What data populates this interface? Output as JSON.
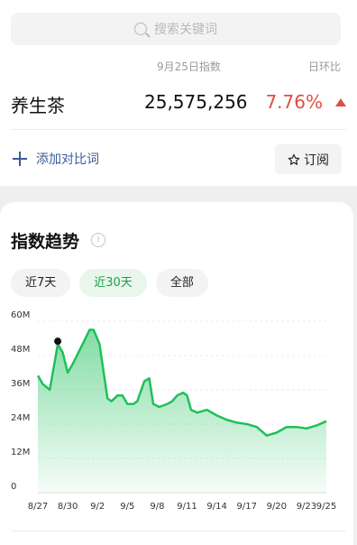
{
  "search": {
    "placeholder": "搜索关键词"
  },
  "header": {
    "date_label": "9月25日指数",
    "ratio_label": "日环比"
  },
  "row": {
    "keyword": "养生茶",
    "value": "25,575,256",
    "ratio": "7.76%"
  },
  "actions": {
    "add_compare": "添加对比词",
    "subscribe": "订阅"
  },
  "trend": {
    "title": "指数趋势",
    "info": "i",
    "tabs": [
      "近7天",
      "近30天",
      "全部"
    ],
    "active_tab": "近30天"
  },
  "chart_data": {
    "type": "area",
    "color": "#1ec05a",
    "ylim": [
      0,
      60
    ],
    "y_ticks": [
      "0",
      "12M",
      "24M",
      "36M",
      "48M",
      "60M"
    ],
    "y_tick_values": [
      0,
      12,
      24,
      36,
      48,
      60
    ],
    "x_ticks": [
      "8/27",
      "8/30",
      "9/2",
      "9/5",
      "9/8",
      "9/11",
      "9/14",
      "9/17",
      "9/20",
      "9/23",
      "9/25"
    ],
    "x_tick_days": [
      0,
      3,
      6,
      9,
      12,
      15,
      18,
      21,
      24,
      27,
      29
    ],
    "x": [
      0,
      0.5,
      1.2,
      1.6,
      2.0,
      2.5,
      3.0,
      3.5,
      4.5,
      5.2,
      5.6,
      6.2,
      7.0,
      7.4,
      8.0,
      8.5,
      9.0,
      9.6,
      10.0,
      10.7,
      11.2,
      11.6,
      12.2,
      13.0,
      13.5,
      14.0,
      14.6,
      15.0,
      15.4,
      16.0,
      17.0,
      18.0,
      19.0,
      20.0,
      21.0,
      22.0,
      23.0,
      24.0,
      25.0,
      26.0,
      27.0,
      28.0,
      29.0
    ],
    "y": [
      41,
      38,
      36,
      44,
      52,
      49,
      42,
      45,
      52,
      57,
      57,
      52,
      33,
      32,
      34,
      34,
      31,
      31,
      32,
      39,
      40,
      31,
      30,
      31,
      32,
      34,
      35,
      34,
      29,
      28,
      29,
      27,
      25.5,
      24.5,
      24,
      23,
      20,
      21,
      23,
      23,
      22.5,
      23.5,
      25
    ],
    "marker": {
      "x": 2.0,
      "y": 53
    }
  }
}
